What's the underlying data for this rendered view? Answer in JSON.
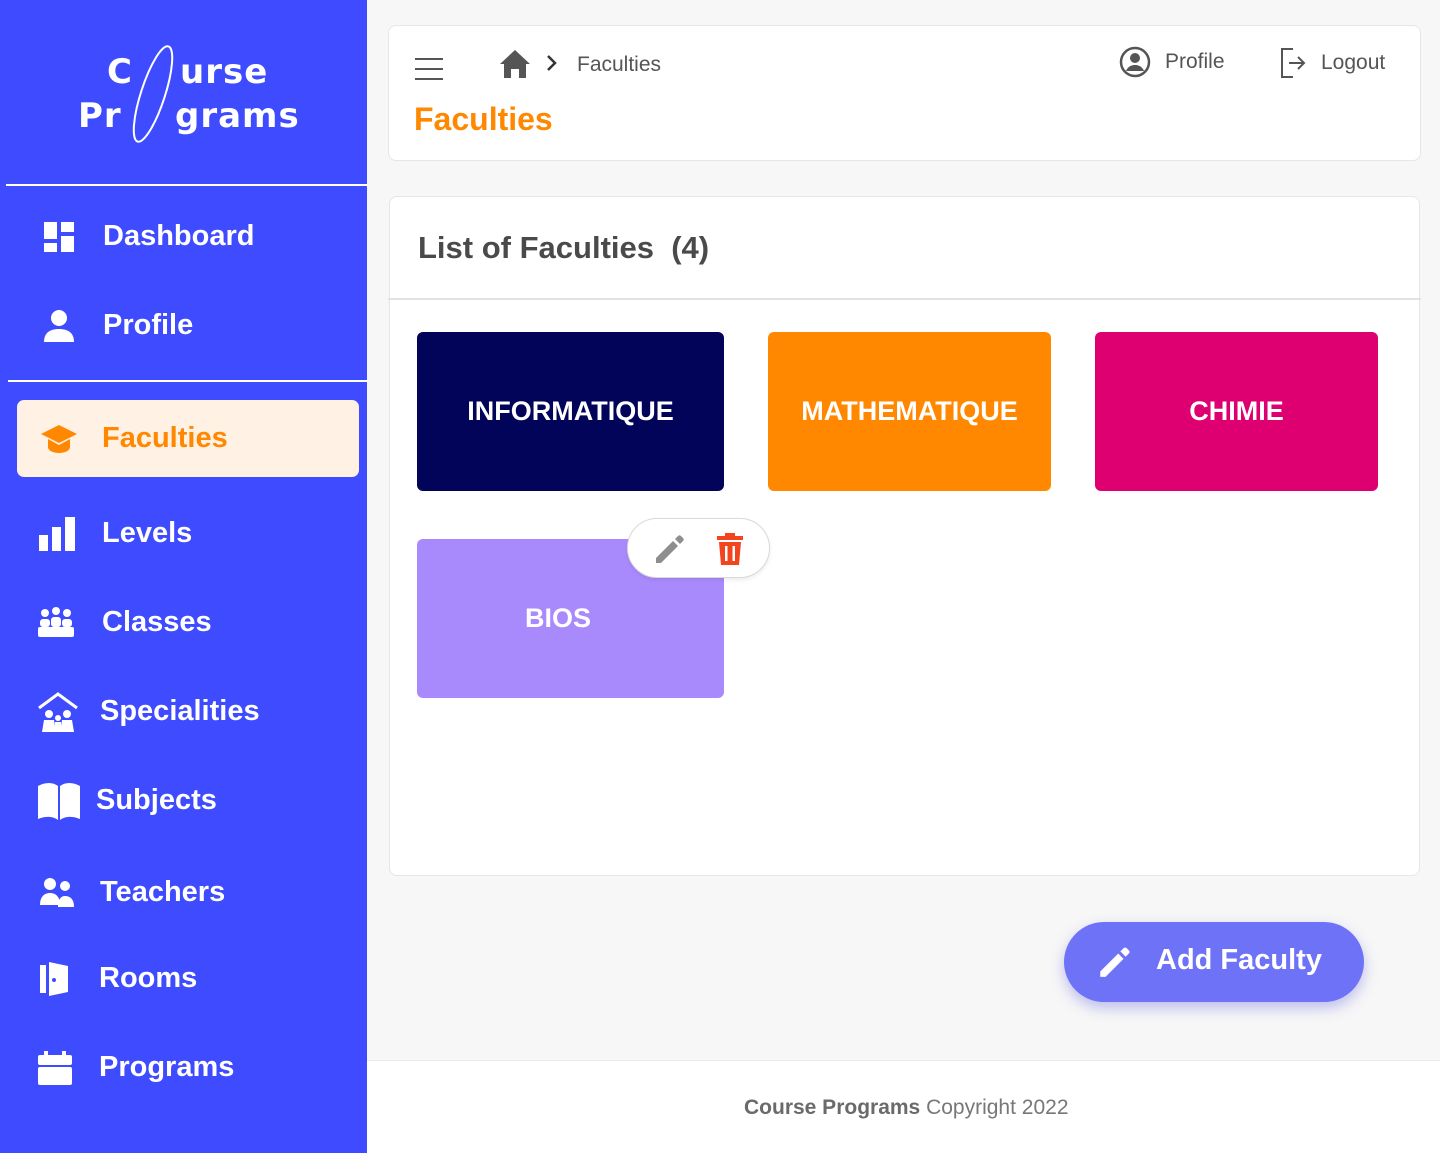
{
  "brand": {
    "logo_line1_a": "C",
    "logo_line1_b": "urse",
    "logo_line2_a": "Pr",
    "logo_line2_b": "grams"
  },
  "sidebar": {
    "items": [
      {
        "label": "Dashboard",
        "icon": "dashboard-icon"
      },
      {
        "label": "Profile",
        "icon": "user-icon"
      },
      {
        "label": "Faculties",
        "icon": "graduation-cap-icon",
        "active": true
      },
      {
        "label": "Levels",
        "icon": "bar-chart-icon"
      },
      {
        "label": "Classes",
        "icon": "group-icon"
      },
      {
        "label": "Specialities",
        "icon": "family-house-icon"
      },
      {
        "label": "Subjects",
        "icon": "book-icon"
      },
      {
        "label": "Teachers",
        "icon": "people-icon"
      },
      {
        "label": "Rooms",
        "icon": "door-icon"
      },
      {
        "label": "Programs",
        "icon": "calendar-icon"
      }
    ]
  },
  "header": {
    "breadcrumb_current": "Faculties",
    "page_title": "Faculties",
    "profile_label": "Profile",
    "logout_label": "Logout"
  },
  "list": {
    "title": "List of Faculties",
    "count": "(4)",
    "faculties": [
      {
        "name": "INFORMATIQUE",
        "color": "#02045a"
      },
      {
        "name": "MATHEMATIQUE",
        "color": "#ff8800"
      },
      {
        "name": "CHIMIE",
        "color": "#de0070"
      },
      {
        "name": "BIOS",
        "color": "#a98afd"
      }
    ]
  },
  "actions": {
    "edit_icon": "pencil-icon",
    "delete_icon": "trash-icon"
  },
  "fab": {
    "label": "Add Faculty"
  },
  "footer": {
    "brand": "Course Programs",
    "text": " Copyright 2022"
  },
  "colors": {
    "sidebar": "#3e4bff",
    "accent": "#ff8800",
    "fab": "#6d72f7",
    "delete": "#f2451d"
  }
}
